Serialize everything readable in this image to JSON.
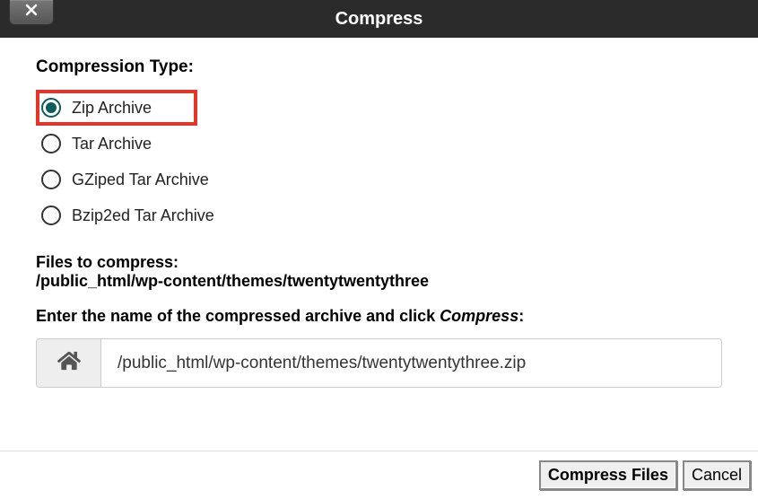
{
  "dialog": {
    "title": "Compress"
  },
  "compression": {
    "label": "Compression Type:",
    "options": [
      {
        "label": "Zip Archive",
        "checked": true
      },
      {
        "label": "Tar Archive",
        "checked": false
      },
      {
        "label": "GZiped Tar Archive",
        "checked": false
      },
      {
        "label": "Bzip2ed Tar Archive",
        "checked": false
      }
    ]
  },
  "files": {
    "label": "Files to compress:",
    "path": "/public_html/wp-content/themes/twentytwentythree"
  },
  "archive": {
    "prompt_prefix": "Enter the name of the compressed archive and click ",
    "prompt_em": "Compress",
    "prompt_suffix": ":",
    "value": "/public_html/wp-content/themes/twentytwentythree.zip"
  },
  "buttons": {
    "compress": "Compress Files",
    "cancel": "Cancel"
  }
}
